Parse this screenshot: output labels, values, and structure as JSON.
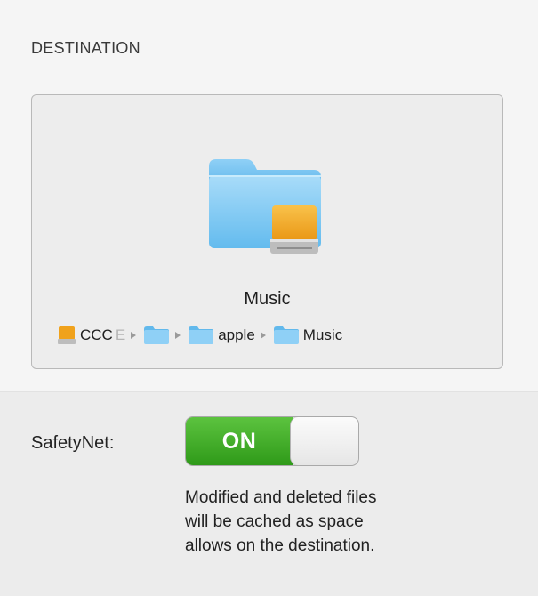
{
  "destination": {
    "heading": "DESTINATION",
    "name": "Music",
    "path": [
      {
        "icon": "drive-icon",
        "label": "CCC",
        "truncated": "E"
      },
      {
        "icon": "folder-icon",
        "label": ""
      },
      {
        "icon": "folder-icon",
        "label": "apple"
      },
      {
        "icon": "folder-icon",
        "label": "Music"
      }
    ]
  },
  "safetynet": {
    "label": "SafetyNet:",
    "state": "ON",
    "description_lines": [
      "Modified and deleted files",
      "will be cached as space",
      "allows on the destination."
    ]
  },
  "colors": {
    "folder": "#5bb8ee",
    "drive": "#f0a21c",
    "toggle_on": "#3aa824"
  }
}
